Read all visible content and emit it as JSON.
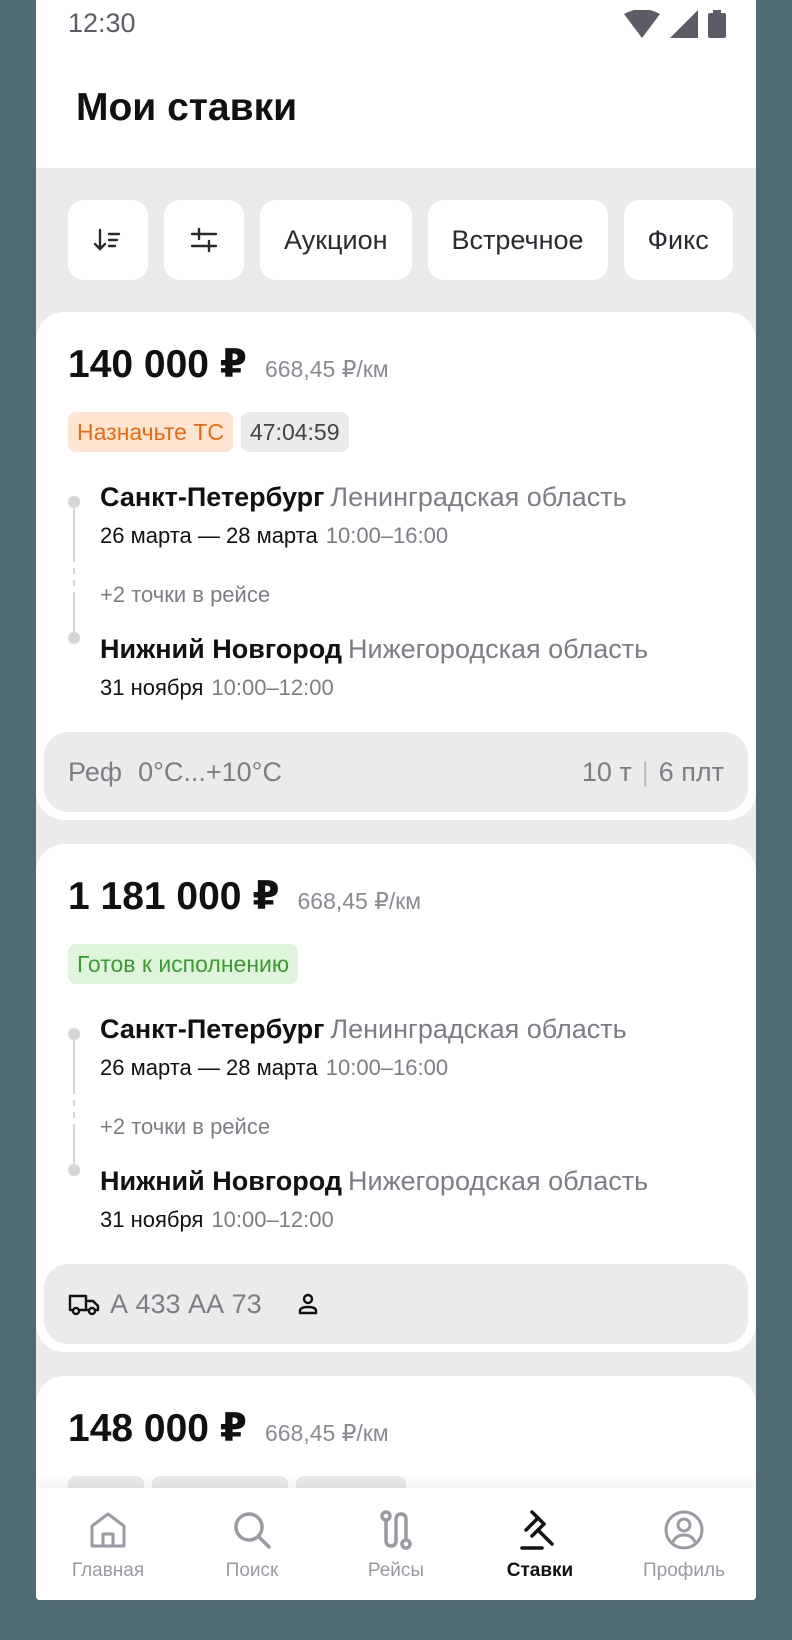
{
  "status_bar": {
    "time": "12:30"
  },
  "header": {
    "title": "Мои ставки"
  },
  "filters": {
    "chips": [
      "Аукцион",
      "Встречное",
      "Фикс"
    ]
  },
  "cards": [
    {
      "price": "140 000 ₽",
      "per_km": "668,45 ₽/км",
      "badges": [
        {
          "text": "Назначьте ТС",
          "style": "orange"
        },
        {
          "text": "47:04:59",
          "style": "grey"
        }
      ],
      "from": {
        "city": "Санкт-Петербург",
        "region": "Ленинградская область",
        "date": "26 марта — 28 марта",
        "time": "10:00–16:00"
      },
      "extra_points": "+2 точки в рейсе",
      "to": {
        "city": "Нижний Новгород",
        "region": "Нижегородская область",
        "date": "31 ноября",
        "time": "10:00–12:00"
      },
      "footer": {
        "type": "Реф",
        "temp": "0°C...+10°C",
        "weight": "10 т",
        "pallets": "6 плт"
      }
    },
    {
      "price": "1 181 000 ₽",
      "per_km": "668,45 ₽/км",
      "badges": [
        {
          "text": "Готов к исполнению",
          "style": "green"
        }
      ],
      "from": {
        "city": "Санкт-Петербург",
        "region": "Ленинградская область",
        "date": "26 марта — 28 марта",
        "time": "10:00–16:00"
      },
      "extra_points": "+2 точки в рейсе",
      "to": {
        "city": "Нижний Новгород",
        "region": "Нижегородская область",
        "date": "31 ноября",
        "time": "10:00–12:00"
      },
      "footer": {
        "plate": "А 433 АА 73"
      }
    },
    {
      "price": "148 000 ₽",
      "per_km": "668,45 ₽/км"
    }
  ],
  "nav": {
    "items": [
      {
        "label": "Главная",
        "icon": "home-icon",
        "active": false
      },
      {
        "label": "Поиск",
        "icon": "search-icon",
        "active": false
      },
      {
        "label": "Рейсы",
        "icon": "route-icon",
        "active": false
      },
      {
        "label": "Ставки",
        "icon": "gavel-icon",
        "active": true
      },
      {
        "label": "Профиль",
        "icon": "profile-icon",
        "active": false
      }
    ]
  },
  "colors": {
    "accent_orange": "#ee6a0c",
    "accent_green": "#3a9c30",
    "background": "#ebebeb",
    "outer": "#4f6a72"
  }
}
